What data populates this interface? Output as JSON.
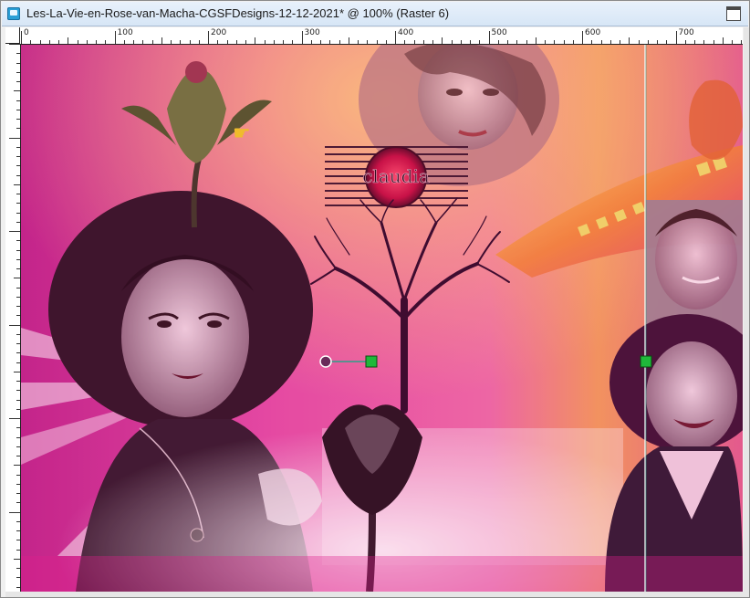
{
  "window": {
    "title": "Les-La-Vie-en-Rose-van-Macha-CGSFDesigns-12-12-2021* @ 100% (Raster 6)"
  },
  "ruler": {
    "h_labels": [
      "0",
      "100",
      "200",
      "300",
      "400",
      "500",
      "600",
      "700"
    ]
  },
  "canvas": {
    "watermark": "claudia"
  },
  "colors": {
    "magenta": "#e0208c",
    "pink": "#f07ac8",
    "orange": "#f39a3a",
    "purple": "#4a1a4a",
    "guide": "#2aa08a",
    "handle_green": "#1fb83a"
  },
  "icons": {
    "app": "raster-image-icon",
    "maximize": "maximize-icon",
    "pointer": "pointing-hand-icon",
    "rotation_handle": "rotation-handle-icon"
  }
}
